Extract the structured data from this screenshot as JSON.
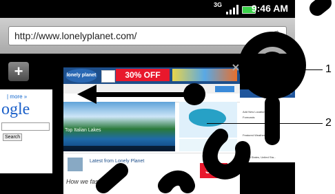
{
  "status_bar": {
    "network": "3G",
    "time": "9:46 AM",
    "battery_color": "#3bd24a"
  },
  "browser": {
    "url": "http://www.lonelyplanet.com/"
  },
  "tabs": {
    "left_page": {
      "links": "| more »",
      "logo": "ogle",
      "button": "Search"
    },
    "main_page": {
      "sale_banner": "30% OFF SALE",
      "hero_caption": "Top Italian Lakes",
      "story_title": "Latest from Lonely Planet",
      "story_subtitle": "How we fashion...",
      "ad_label": "30%"
    },
    "right_page": {
      "header": "AccuWe",
      "lines": [
        "Add New Location",
        "Forecasts",
        "Featured Weather",
        "United States, United Sta..."
      ]
    }
  },
  "callouts": [
    "1",
    "2"
  ],
  "watermark_color": "#000000"
}
